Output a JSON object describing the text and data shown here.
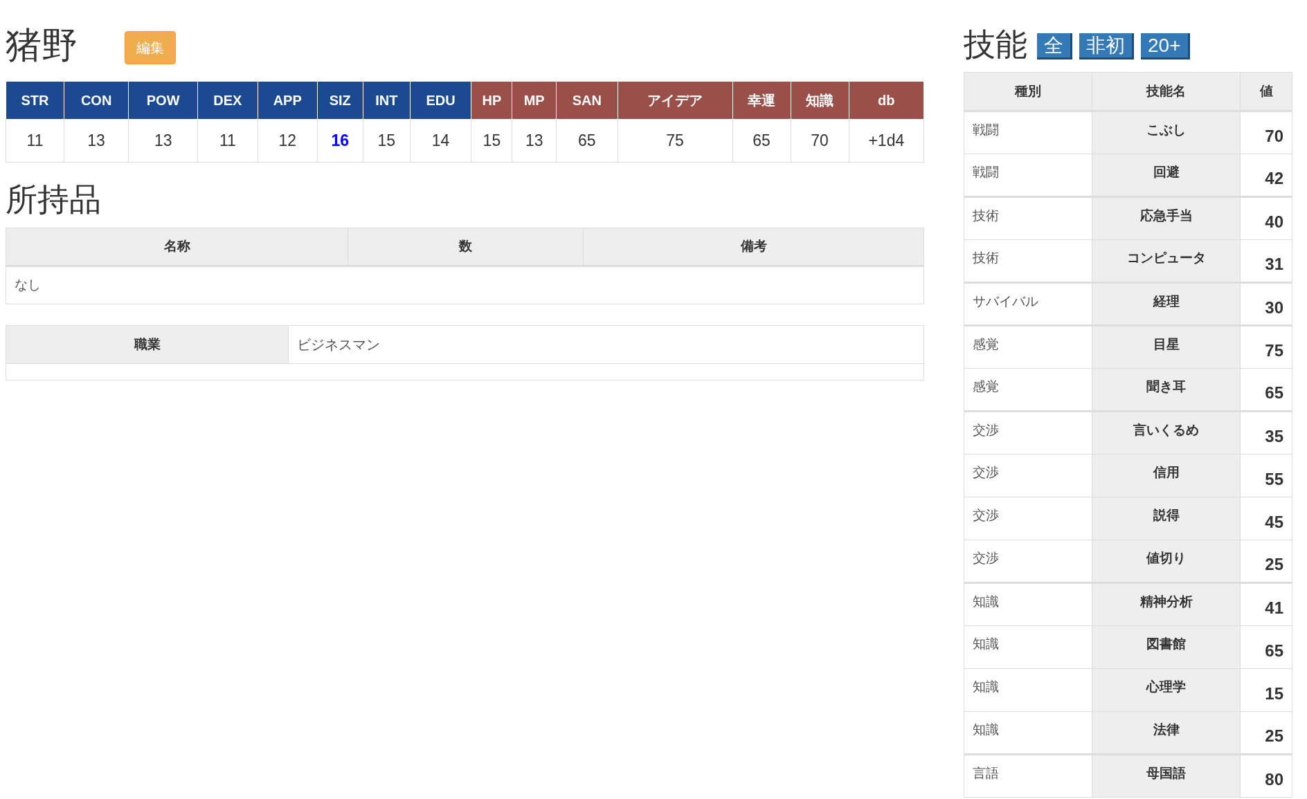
{
  "character": {
    "name": "猪野",
    "edit_button": "編集"
  },
  "stats": [
    {
      "label": "STR",
      "value": "11",
      "kind": "ability",
      "highlight": false
    },
    {
      "label": "CON",
      "value": "13",
      "kind": "ability",
      "highlight": false
    },
    {
      "label": "POW",
      "value": "13",
      "kind": "ability",
      "highlight": false
    },
    {
      "label": "DEX",
      "value": "11",
      "kind": "ability",
      "highlight": false
    },
    {
      "label": "APP",
      "value": "12",
      "kind": "ability",
      "highlight": false
    },
    {
      "label": "SIZ",
      "value": "16",
      "kind": "ability",
      "highlight": true
    },
    {
      "label": "INT",
      "value": "15",
      "kind": "ability",
      "highlight": false
    },
    {
      "label": "EDU",
      "value": "14",
      "kind": "ability",
      "highlight": false
    },
    {
      "label": "HP",
      "value": "15",
      "kind": "derived",
      "highlight": false
    },
    {
      "label": "MP",
      "value": "13",
      "kind": "derived",
      "highlight": false
    },
    {
      "label": "SAN",
      "value": "65",
      "kind": "derived",
      "highlight": false
    },
    {
      "label": "アイデア",
      "value": "75",
      "kind": "derived",
      "highlight": false
    },
    {
      "label": "幸運",
      "value": "65",
      "kind": "derived",
      "highlight": false
    },
    {
      "label": "知識",
      "value": "70",
      "kind": "derived",
      "highlight": false
    },
    {
      "label": "db",
      "value": "+1d4",
      "kind": "derived",
      "highlight": false
    }
  ],
  "inventory": {
    "title": "所持品",
    "columns": [
      "名称",
      "数",
      "備考"
    ],
    "empty_message": "なし"
  },
  "occupation": {
    "label": "職業",
    "value": "ビジネスマン"
  },
  "skills": {
    "title": "技能",
    "filters": [
      "全",
      "非初",
      "20+"
    ],
    "columns": [
      "種別",
      "技能名",
      "値"
    ],
    "groups": [
      {
        "rows": [
          {
            "category": "戦闘",
            "name": "こぶし",
            "value": "70"
          },
          {
            "category": "戦闘",
            "name": "回避",
            "value": "42"
          }
        ]
      },
      {
        "rows": [
          {
            "category": "技術",
            "name": "応急手当",
            "value": "40"
          },
          {
            "category": "技術",
            "name": "コンピュータ",
            "value": "31"
          }
        ]
      },
      {
        "rows": [
          {
            "category": "サバイバル",
            "name": "経理",
            "value": "30"
          }
        ]
      },
      {
        "rows": [
          {
            "category": "感覚",
            "name": "目星",
            "value": "75"
          },
          {
            "category": "感覚",
            "name": "聞き耳",
            "value": "65"
          }
        ]
      },
      {
        "rows": [
          {
            "category": "交渉",
            "name": "言いくるめ",
            "value": "35"
          },
          {
            "category": "交渉",
            "name": "信用",
            "value": "55"
          },
          {
            "category": "交渉",
            "name": "説得",
            "value": "45"
          },
          {
            "category": "交渉",
            "name": "値切り",
            "value": "25"
          }
        ]
      },
      {
        "rows": [
          {
            "category": "知識",
            "name": "精神分析",
            "value": "41"
          },
          {
            "category": "知識",
            "name": "図書館",
            "value": "65"
          },
          {
            "category": "知識",
            "name": "心理学",
            "value": "15"
          },
          {
            "category": "知識",
            "name": "法律",
            "value": "25"
          }
        ]
      },
      {
        "rows": [
          {
            "category": "言語",
            "name": "母国語",
            "value": "80"
          }
        ]
      }
    ]
  }
}
